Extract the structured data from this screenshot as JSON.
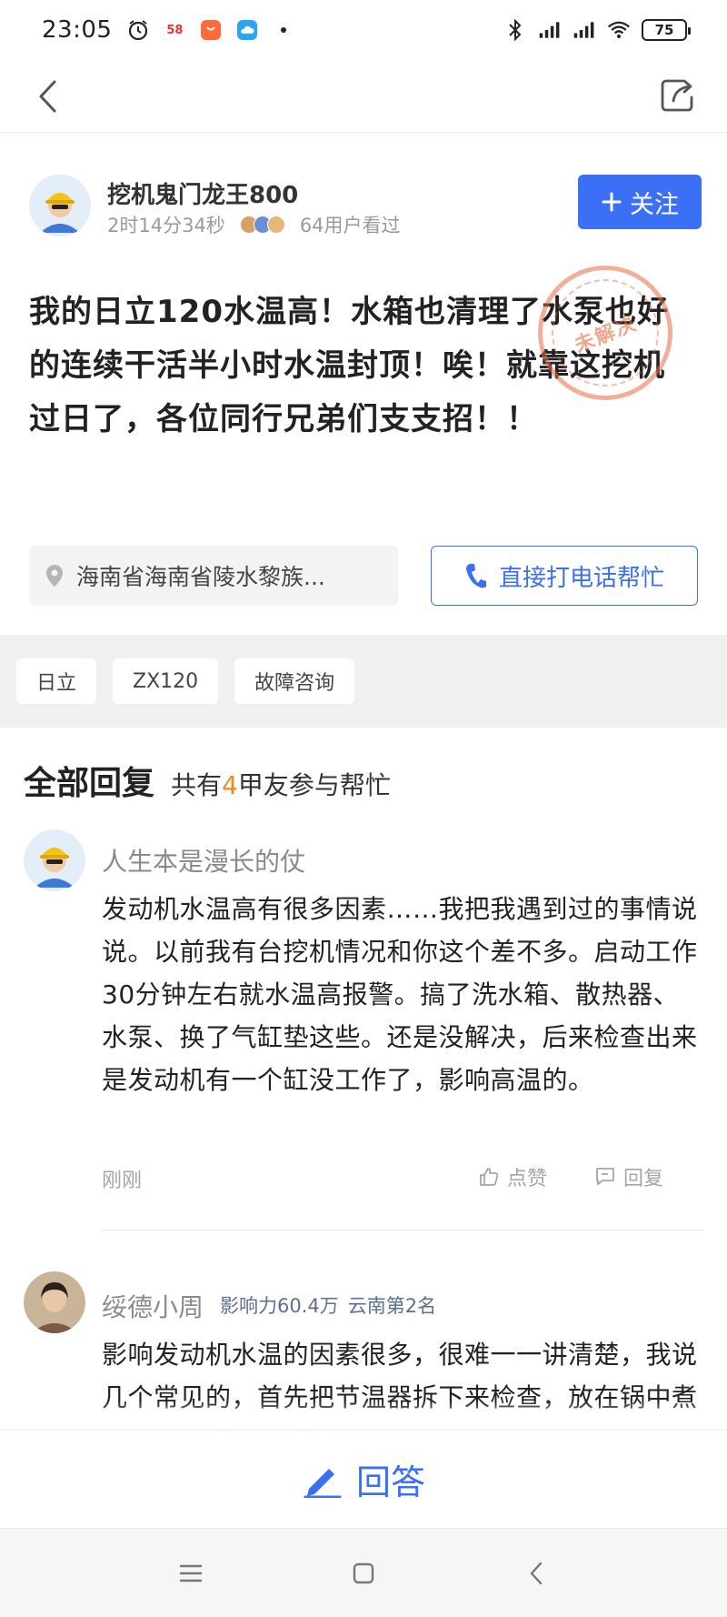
{
  "status_bar": {
    "time": "23:05",
    "battery_level": "75",
    "app_badge": "58"
  },
  "post": {
    "author_name": "挖机鬼门龙王800",
    "elapsed": "2时14分34秒",
    "viewers": "64用户看过",
    "follow_label": "关注",
    "question_text": " 我的日立120水温高！水箱也清理了水泵也好的连续干活半小时水温封顶！唉！就靠这挖机过日了，各位同行兄弟们支支招！！",
    "stamp_text": "未解决",
    "location": "海南省海南省陵水黎族...",
    "call_label": "直接打电话帮忙",
    "tags": [
      "日立",
      "ZX120",
      "故障咨询"
    ]
  },
  "replies": {
    "title": "全部回复",
    "sub_prefix": "共有",
    "count": "4",
    "sub_suffix": "甲友参与帮忙",
    "items": [
      {
        "name": "人生本是漫长的仗",
        "body": " 发动机水温高有很多因素……我把我遇到过的事情说说。以前我有台挖机情况和你这个差不多。启动工作30分钟左右就水温高报警。搞了洗水箱、散热器、水泵、换了气缸垫这些。还是没解决，后来检查出来是发动机有一个缸没工作了，影响高温的。",
        "time": "刚刚",
        "like_label": "点赞",
        "reply_label": "回复"
      },
      {
        "name": "绥德小周",
        "badge_influence": "影响力60.4万",
        "badge_rank": "云南第2名",
        "body": " 影响发动机水温的因素很多，很难一一讲清楚，我说几个常见的，首先把节温器拆下来检查，放在锅中煮一煮，看看打开后节温器有没"
      }
    ]
  },
  "answer_bar": {
    "label": "回答"
  },
  "colors": {
    "accent": "#3b6ff5",
    "count_orange": "#f08a1e",
    "stamp": "#e66e46"
  }
}
